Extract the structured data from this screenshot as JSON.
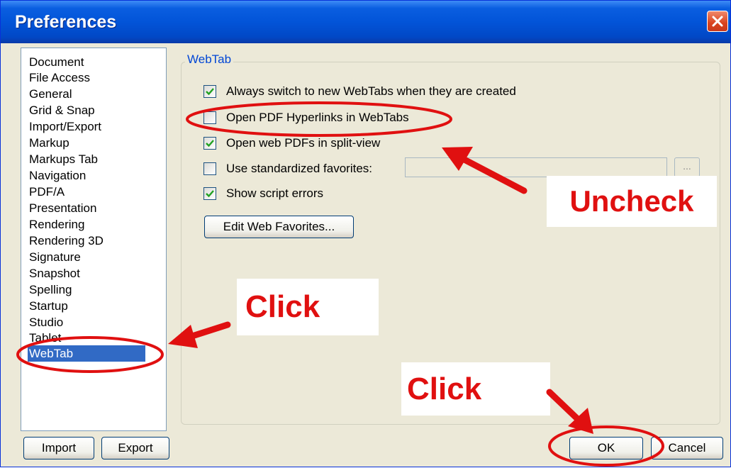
{
  "window": {
    "title": "Preferences"
  },
  "sidebar": {
    "items": [
      {
        "label": "Document"
      },
      {
        "label": "File Access"
      },
      {
        "label": "General"
      },
      {
        "label": "Grid & Snap"
      },
      {
        "label": "Import/Export"
      },
      {
        "label": "Markup"
      },
      {
        "label": "Markups Tab"
      },
      {
        "label": "Navigation"
      },
      {
        "label": "PDF/A"
      },
      {
        "label": "Presentation"
      },
      {
        "label": "Rendering"
      },
      {
        "label": "Rendering 3D"
      },
      {
        "label": "Signature"
      },
      {
        "label": "Snapshot"
      },
      {
        "label": "Spelling"
      },
      {
        "label": "Startup"
      },
      {
        "label": "Studio"
      },
      {
        "label": "Tablet"
      },
      {
        "label": "WebTab",
        "selected": true
      }
    ]
  },
  "group": {
    "title": "WebTab",
    "options": [
      {
        "label": "Always switch to new WebTabs when they are created",
        "checked": true
      },
      {
        "label": "Open PDF Hyperlinks in WebTabs",
        "checked": false
      },
      {
        "label": "Open web PDFs in split-view",
        "checked": true
      },
      {
        "label": "Use standardized favorites:",
        "checked": false
      },
      {
        "label": "Show script errors",
        "checked": true
      }
    ],
    "favorites_value": "",
    "browse_label": "...",
    "edit_favorites_label": "Edit Web Favorites..."
  },
  "footer": {
    "import_label": "Import",
    "export_label": "Export",
    "ok_label": "OK",
    "cancel_label": "Cancel"
  },
  "annotations": {
    "uncheck": "Uncheck",
    "click_sidebar": "Click",
    "click_ok": "Click"
  },
  "colors": {
    "title_bar": "#0254d8",
    "selection": "#316ac5",
    "annotation_red": "#e01010",
    "group_title": "#0046d5"
  }
}
